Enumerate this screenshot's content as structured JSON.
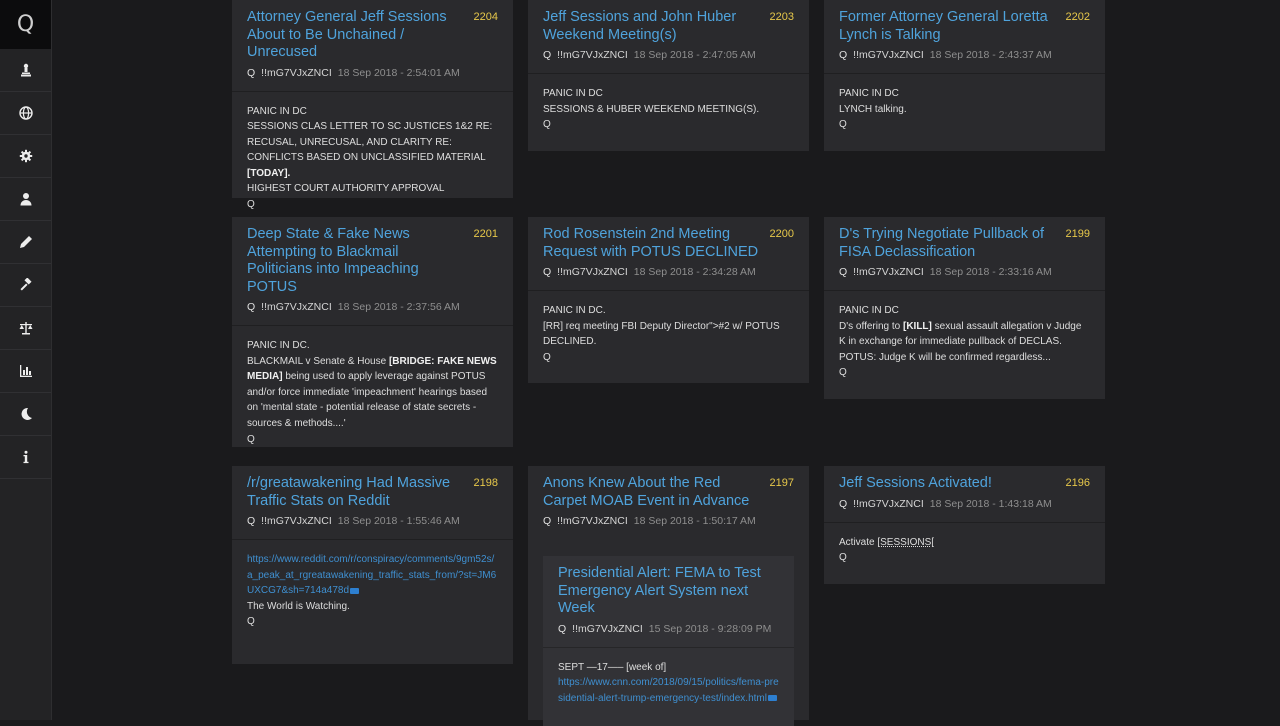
{
  "logo": "Q",
  "nav": [
    {
      "name": "chess-pawn-icon"
    },
    {
      "name": "globe-icon"
    },
    {
      "name": "settings-gear-icon"
    },
    {
      "name": "user-icon"
    },
    {
      "name": "pencil-icon"
    },
    {
      "name": "gavel-icon"
    },
    {
      "name": "scales-icon"
    },
    {
      "name": "bar-chart-icon"
    },
    {
      "name": "moon-icon"
    },
    {
      "name": "info-icon"
    }
  ],
  "posts": [
    {
      "title": "Attorney General Jeff Sessions About to Be Unchained / Unrecused",
      "num": "2204",
      "q": "Q",
      "trip": "!!mG7VJxZNCI",
      "date": "18 Sep 2018 - 2:54:01 AM",
      "lines": [
        "PANIC IN DC",
        "SESSIONS CLAS LETTER TO SC JUSTICES 1&2 RE: RECUSAL, UNRECUSAL, AND CLARITY RE: CONFLICTS BASED ON UNCLASSIFIED MATERIAL",
        "[TODAY].",
        "HIGHEST COURT AUTHORITY APPROVAL",
        "Q"
      ]
    },
    {
      "title": "Jeff Sessions and John Huber Weekend Meeting(s)",
      "num": "2203",
      "q": "Q",
      "trip": "!!mG7VJxZNCI",
      "date": "18 Sep 2018 - 2:47:05 AM",
      "lines": [
        "PANIC IN DC",
        "SESSIONS & HUBER WEEKEND MEETING(S).",
        "Q"
      ]
    },
    {
      "title": "Former Attorney General Loretta Lynch is Talking",
      "num": "2202",
      "q": "Q",
      "trip": "!!mG7VJxZNCI",
      "date": "18 Sep 2018 - 2:43:37 AM",
      "lines": [
        "PANIC IN DC",
        "LYNCH talking.",
        "Q"
      ]
    },
    {
      "title": "Deep State & Fake News Attempting to Blackmail Politicians into Impeaching POTUS",
      "num": "2201",
      "q": "Q",
      "trip": "!!mG7VJxZNCI",
      "date": "18 Sep 2018 - 2:37:56 AM",
      "lines": [
        "PANIC IN DC.",
        "BLACKMAIL v Senate & House",
        "[BRIDGE: FAKE NEWS MEDIA]",
        "being used to apply leverage against POTUS and/or force immediate 'impeachment' hearings based on 'mental state - potential release of state secrets - sources & methods....'",
        "Q"
      ]
    },
    {
      "title": "Rod Rosenstein 2nd Meeting Request with POTUS DECLINED",
      "num": "2200",
      "q": "Q",
      "trip": "!!mG7VJxZNCI",
      "date": "18 Sep 2018 - 2:34:28 AM",
      "lines": [
        "PANIC IN DC.",
        "[RR] req meeting FBI Deputy Director\">#2 w/ POTUS DECLINED.",
        "Q"
      ]
    },
    {
      "title": "D's Trying Negotiate Pullback of FISA Declassification",
      "num": "2199",
      "q": "Q",
      "trip": "!!mG7VJxZNCI",
      "date": "18 Sep 2018 - 2:33:16 AM",
      "lines": [
        "PANIC IN DC",
        "D's offering to",
        "[KILL]",
        "sexual assault allegation v Judge K in exchange for immediate pullback of DECLAS.",
        "POTUS: Judge K will be confirmed regardless...",
        "Q"
      ]
    },
    {
      "title": "/r/greatawakening Had Massive Traffic Stats on Reddit",
      "num": "2198",
      "q": "Q",
      "trip": "!!mG7VJxZNCI",
      "date": "18 Sep 2018 - 1:55:46 AM",
      "lines": [
        "https://www.reddit.com/r/conspiracy/comments/9gm52s/a_peak_at_rgreatawakening_traffic_stats_from/?st=JM6UXCG7&sh=714a478d",
        "The World is Watching.",
        "Q"
      ]
    },
    {
      "title": "Anons Knew About the Red Carpet MOAB Event in Advance",
      "num": "2197",
      "q": "Q",
      "trip": "!!mG7VJxZNCI",
      "date": "18 Sep 2018 - 1:50:17 AM",
      "quote": {
        "title": "Presidential Alert: FEMA to Test Emergency Alert System next Week",
        "q": "Q",
        "trip": "!!mG7VJxZNCI",
        "date": "15 Sep 2018 - 9:28:09 PM",
        "lines": [
          "SEPT —17—– [week of]",
          "https://www.cnn.com/2018/09/15/politics/fema-presidential-alert-trump-emergency-test/index.html"
        ]
      }
    },
    {
      "title": "Jeff Sessions Activated!",
      "num": "2196",
      "q": "Q",
      "trip": "!!mG7VJxZNCI",
      "date": "18 Sep 2018 - 1:43:18 AM",
      "lines": [
        "Activate",
        "[SESSIONS[",
        "Q"
      ]
    }
  ]
}
